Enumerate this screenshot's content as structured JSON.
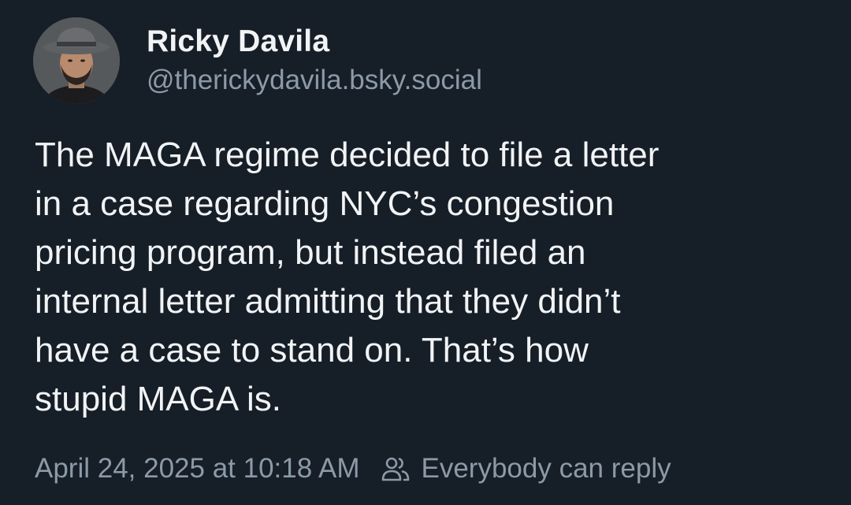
{
  "author": {
    "display_name": "Ricky Davila",
    "handle": "@therickydavila.bsky.social",
    "avatar_icon": "profile-photo"
  },
  "post": {
    "text": "The MAGA regime decided to file a letter\nin a case regarding NYC’s congestion\npricing program, but instead filed an\ninternal letter admitting that they didn’t\nhave a case to stand on. That’s how\nstupid MAGA is.",
    "timestamp": "April 24, 2025 at 10:18 AM",
    "reply_setting": "Everybody can reply",
    "reply_icon": "users-icon"
  },
  "colors": {
    "background": "#161e27",
    "primary_text": "#f1f3f5",
    "secondary_text": "#8c9aa8"
  }
}
